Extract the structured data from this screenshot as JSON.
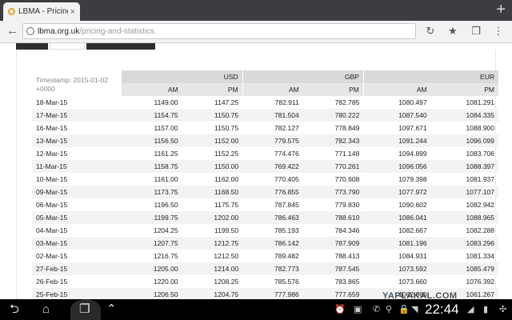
{
  "browser": {
    "tab_title": "LBMA - Pricing an",
    "tab_close": "×",
    "new_tab": "+",
    "url_host": "lbma.org.uk",
    "url_path": "/pricing-and-statistics",
    "back_icon": "←",
    "reload_icon": "↻",
    "star_icon": "★",
    "tabs_icon": "❐",
    "menu_icon": "⋮"
  },
  "table": {
    "timestamp": "Timestamp: 2015-01-02 +0000",
    "currencies": [
      "USD",
      "GBP",
      "EUR"
    ],
    "am_label": "AM",
    "pm_label": "PM",
    "rows": [
      [
        "18-Mar-15",
        "1149.00",
        "1147.25",
        "782.911",
        "782.785",
        "1080.497",
        "1081.291"
      ],
      [
        "17-Mar-15",
        "1154.75",
        "1150.75",
        "781.504",
        "780.222",
        "1087.540",
        "1084.335"
      ],
      [
        "16-Mar-15",
        "1157.00",
        "1150.75",
        "782.127",
        "778.849",
        "1097.671",
        "1088.900"
      ],
      [
        "13-Mar-15",
        "1156.50",
        "1152.00",
        "779.575",
        "782.343",
        "1091.244",
        "1096.099"
      ],
      [
        "12-Mar-15",
        "1161.25",
        "1152.25",
        "774.476",
        "771.148",
        "1094.899",
        "1083.706"
      ],
      [
        "11-Mar-15",
        "1158.75",
        "1150.00",
        "769.422",
        "770.261",
        "1096.056",
        "1088.397"
      ],
      [
        "10-Mar-15",
        "1161.00",
        "1162.00",
        "770.405",
        "770.608",
        "1079.398",
        "1081.937"
      ],
      [
        "09-Mar-15",
        "1173.75",
        "1168.50",
        "776.855",
        "773.790",
        "1077.972",
        "1077.107"
      ],
      [
        "06-Mar-15",
        "1196.50",
        "1175.75",
        "787.845",
        "779.830",
        "1090.602",
        "1082.942"
      ],
      [
        "05-Mar-15",
        "1199.75",
        "1202.00",
        "786.463",
        "788.610",
        "1086.041",
        "1088.965"
      ],
      [
        "04-Mar-15",
        "1204.25",
        "1199.50",
        "785.193",
        "784.346",
        "1082.667",
        "1082.288"
      ],
      [
        "03-Mar-15",
        "1207.75",
        "1212.75",
        "786.142",
        "787.909",
        "1081.196",
        "1083.296"
      ],
      [
        "02-Mar-15",
        "1216.75",
        "1212.50",
        "789.482",
        "788.413",
        "1084.931",
        "1081.334"
      ],
      [
        "27-Feb-15",
        "1205.00",
        "1214.00",
        "782.773",
        "787.545",
        "1073.592",
        "1085.479"
      ],
      [
        "26-Feb-15",
        "1220.00",
        "1208.25",
        "785.576",
        "783.865",
        "1073.660",
        "1076.392"
      ],
      [
        "25-Feb-15",
        "1206.50",
        "1204.75",
        "777.986",
        "777.659",
        "1062.060",
        "1061.267"
      ]
    ]
  },
  "system": {
    "clock": "22:44",
    "watermark": "YAPLAKAL.COM",
    "nav_back": "⮌",
    "nav_home": "⌂",
    "nav_recent": "❐",
    "nav_menu": "⌃"
  }
}
